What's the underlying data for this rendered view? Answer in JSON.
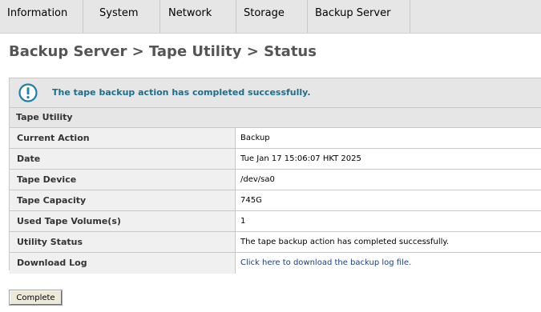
{
  "nav": {
    "tabs": [
      {
        "label": "Information"
      },
      {
        "label": "System"
      },
      {
        "label": "Network"
      },
      {
        "label": "Storage"
      },
      {
        "label": "Backup Server"
      }
    ]
  },
  "page_title": "Backup Server > Tape Utility > Status",
  "notice": {
    "icon": "info-icon",
    "message": "The tape backup action has completed successfully."
  },
  "section_title": "Tape Utility",
  "rows": [
    {
      "label": "Current Action",
      "value": "Backup"
    },
    {
      "label": "Date",
      "value": "Tue Jan 17 15:06:07 HKT 2025"
    },
    {
      "label": "Tape Device",
      "value": "/dev/sa0"
    },
    {
      "label": "Tape Capacity",
      "value": "745G"
    },
    {
      "label": "Used Tape Volume(s)",
      "value": "1"
    },
    {
      "label": "Utility Status",
      "value": "The tape backup action has completed successfully."
    },
    {
      "label": "Download Log",
      "value": "Click here to download the backup log file."
    }
  ],
  "buttons": {
    "complete": "Complete"
  },
  "colors": {
    "nav_bg": "#e6e6e6",
    "title": "#555555",
    "notice_text": "#1a6f8e",
    "link": "#1b3f88",
    "border": "#c8c8c8"
  }
}
